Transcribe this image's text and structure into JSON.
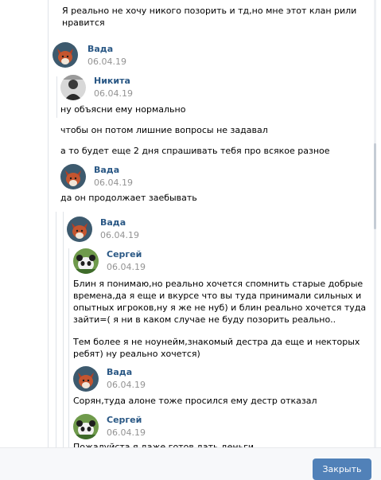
{
  "thread": {
    "top_message": [
      "Я реально не хочу никого позорить и тд,но мне этот клан рили",
      "нравится"
    ],
    "post1": {
      "author": "Вада",
      "date": "06.04.19"
    },
    "post2": {
      "author": "Никита",
      "date": "06.04.19",
      "lines": [
        "ну объясни ему нормально",
        "чтобы он потом лишние вопросы не задавал",
        "а то будет еще 2 дня спрашивать тебя про всякое разное"
      ]
    },
    "post3": {
      "author": "Вада",
      "date": "06.04.19",
      "text": "да он продолжает заебывать"
    },
    "nested": {
      "post4": {
        "author": "Вада",
        "date": "06.04.19"
      },
      "post5": {
        "author": "Сергей",
        "date": "06.04.19",
        "para1": [
          "Блин я понимаю,но реально хочется спомнить старые добрые",
          "времена,да я еще и вкурсе что вы туда принимали сильных и",
          "опытных игроков,ну я же не нуб) и блин реально хочется туда",
          "зайти=( я ни в каком случае не буду позорить реально.."
        ],
        "para2": [
          "Тем более я не ноунейм,знакомый дестра да еще и некторых",
          "ребят) ну реально хочется)"
        ]
      },
      "post6": {
        "author": "Вада",
        "date": "06.04.19",
        "text": "Сорян,туда алоне тоже просился ему дестр отказал"
      },
      "post7": {
        "author": "Сергей",
        "date": "06.04.19",
        "text": "Пожалуйста я даже готов дать деньги"
      }
    }
  },
  "footer": {
    "close_label": "Закрыть"
  },
  "colors": {
    "link": "#2a5885",
    "button": "#5181b8",
    "date": "#939393"
  }
}
